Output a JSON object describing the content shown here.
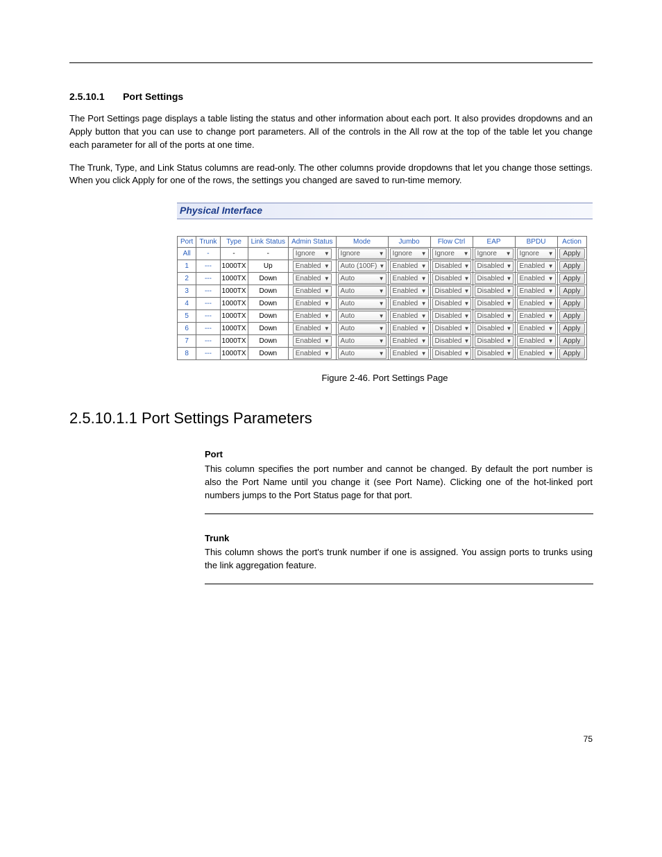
{
  "header": {
    "section_num": "2.5.10.1",
    "section_title": "Port Settings",
    "para1": "The Port Settings page displays a table listing the status and other information about each port. It also provides dropdowns and an Apply button that you can use to change port parameters. All of the controls in the All row at the top of the table let you change each parameter for all of the ports at one time.",
    "para2": "The Trunk, Type, and Link Status columns are read-only. The other columns provide dropdowns that let you change those settings. When you click Apply for one of the rows, the settings you changed are saved to run-time memory."
  },
  "figure": {
    "title": "Physical Interface",
    "caption": "Figure 2-46. Port Settings Page",
    "columns": [
      "Port",
      "Trunk",
      "Type",
      "Link Status",
      "Admin Status",
      "Mode",
      "Jumbo",
      "Flow Ctrl",
      "EAP",
      "BPDU",
      "Action"
    ],
    "rows": [
      {
        "port": "All",
        "trunk": "-",
        "type": "-",
        "link": "-",
        "admin": "Ignore",
        "mode": "Ignore",
        "jumbo": "Ignore",
        "flow": "Ignore",
        "eap": "Ignore",
        "bpdu": "Ignore",
        "action": "Apply"
      },
      {
        "port": "1",
        "trunk": "---",
        "type": "1000TX",
        "link": "Up",
        "admin": "Enabled",
        "mode": "Auto (100F)",
        "jumbo": "Enabled",
        "flow": "Disabled",
        "eap": "Disabled",
        "bpdu": "Enabled",
        "action": "Apply"
      },
      {
        "port": "2",
        "trunk": "---",
        "type": "1000TX",
        "link": "Down",
        "admin": "Enabled",
        "mode": "Auto",
        "jumbo": "Enabled",
        "flow": "Disabled",
        "eap": "Disabled",
        "bpdu": "Enabled",
        "action": "Apply"
      },
      {
        "port": "3",
        "trunk": "---",
        "type": "1000TX",
        "link": "Down",
        "admin": "Enabled",
        "mode": "Auto",
        "jumbo": "Enabled",
        "flow": "Disabled",
        "eap": "Disabled",
        "bpdu": "Enabled",
        "action": "Apply"
      },
      {
        "port": "4",
        "trunk": "---",
        "type": "1000TX",
        "link": "Down",
        "admin": "Enabled",
        "mode": "Auto",
        "jumbo": "Enabled",
        "flow": "Disabled",
        "eap": "Disabled",
        "bpdu": "Enabled",
        "action": "Apply"
      },
      {
        "port": "5",
        "trunk": "---",
        "type": "1000TX",
        "link": "Down",
        "admin": "Enabled",
        "mode": "Auto",
        "jumbo": "Enabled",
        "flow": "Disabled",
        "eap": "Disabled",
        "bpdu": "Enabled",
        "action": "Apply"
      },
      {
        "port": "6",
        "trunk": "---",
        "type": "1000TX",
        "link": "Down",
        "admin": "Enabled",
        "mode": "Auto",
        "jumbo": "Enabled",
        "flow": "Disabled",
        "eap": "Disabled",
        "bpdu": "Enabled",
        "action": "Apply"
      },
      {
        "port": "7",
        "trunk": "---",
        "type": "1000TX",
        "link": "Down",
        "admin": "Enabled",
        "mode": "Auto",
        "jumbo": "Enabled",
        "flow": "Disabled",
        "eap": "Disabled",
        "bpdu": "Enabled",
        "action": "Apply"
      },
      {
        "port": "8",
        "trunk": "---",
        "type": "1000TX",
        "link": "Down",
        "admin": "Enabled",
        "mode": "Auto",
        "jumbo": "Enabled",
        "flow": "Disabled",
        "eap": "Disabled",
        "bpdu": "Enabled",
        "action": "Apply"
      }
    ]
  },
  "sections": {
    "main_title": "2.5.10.1.1 Port Settings Parameters",
    "defs": [
      {
        "label": "Port",
        "text": "This column specifies the port number and cannot be changed. By default the port number is also the Port Name until you change it (see Port Name). Clicking one of the hot-linked port numbers jumps to the Port Status page for that port."
      },
      {
        "label": "Trunk",
        "text": "This column shows the port's trunk number if one is assigned. You assign ports to trunks using the link aggregation feature."
      }
    ]
  },
  "footer": {
    "page_num": "75"
  }
}
